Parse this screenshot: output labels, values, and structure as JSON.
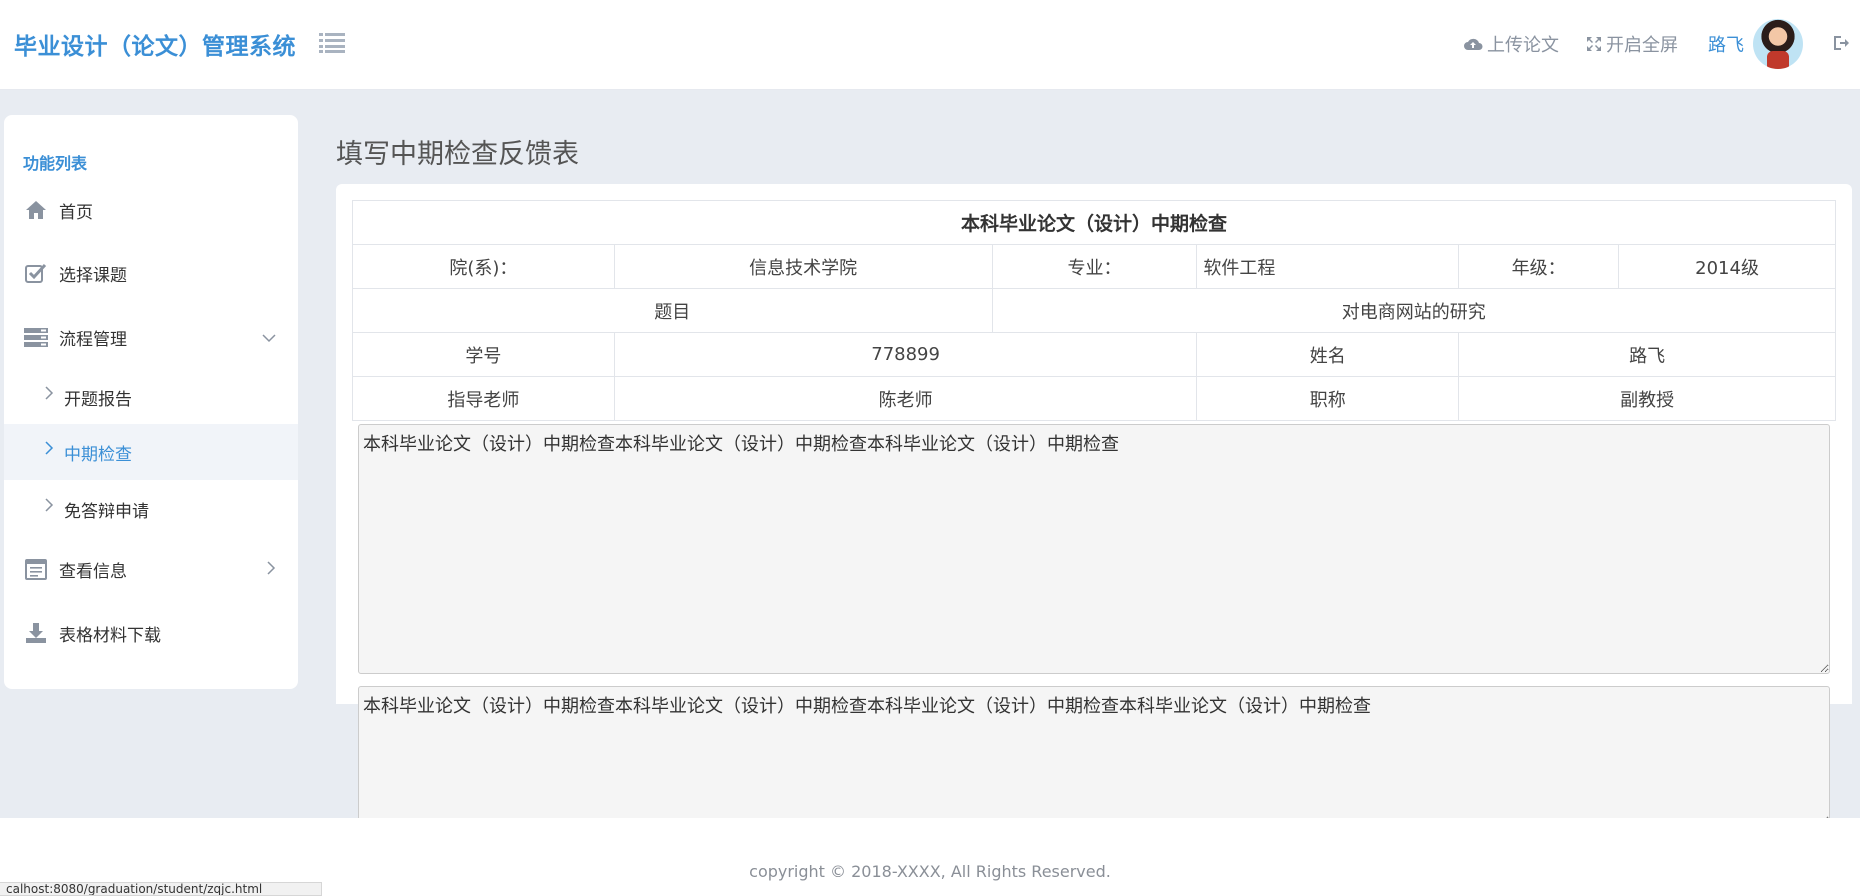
{
  "header": {
    "brand": "毕业设计（论文）管理系统",
    "upload_label": "上传论文",
    "fullscreen_label": "开启全屏",
    "user_name": "路飞"
  },
  "sidebar": {
    "title": "功能列表",
    "items": [
      {
        "label": "首页"
      },
      {
        "label": "选择课题"
      },
      {
        "label": "流程管理"
      },
      {
        "label": "查看信息"
      },
      {
        "label": "表格材料下载"
      }
    ],
    "subitems": [
      {
        "label": "开题报告"
      },
      {
        "label": "中期检查"
      },
      {
        "label": "免答辩申请"
      }
    ]
  },
  "main": {
    "page_title": "填写中期检查反馈表",
    "table": {
      "caption": "本科毕业论文（设计）中期检查",
      "dept_label": "院(系)：",
      "dept_value": "信息技术学院",
      "major_label": "专业：",
      "major_value": "软件工程",
      "grade_label": "年级：",
      "grade_value": "2014级",
      "topic_label": "题目",
      "topic_value": "对电商网站的研究",
      "sid_label": "学号",
      "sid_value": "778899",
      "name_label": "姓名",
      "name_value": "路飞",
      "advisor_label": "指导老师",
      "advisor_value": "陈老师",
      "title_label": "职称",
      "title_value": "副教授"
    },
    "textarea1": "本科毕业论文（设计）中期检查本科毕业论文（设计）中期检查本科毕业论文（设计）中期检查",
    "textarea2": "本科毕业论文（设计）中期检查本科毕业论文（设计）中期检查本科毕业论文（设计）中期检查本科毕业论文（设计）中期检查"
  },
  "footer": {
    "copyright": "copyright © 2018-XXXX, All Rights Reserved.",
    "status_url": "calhost:8080/graduation/student/zqjc.html"
  },
  "colors": {
    "accent": "#3b8fd6",
    "background": "#e8ecf2"
  }
}
